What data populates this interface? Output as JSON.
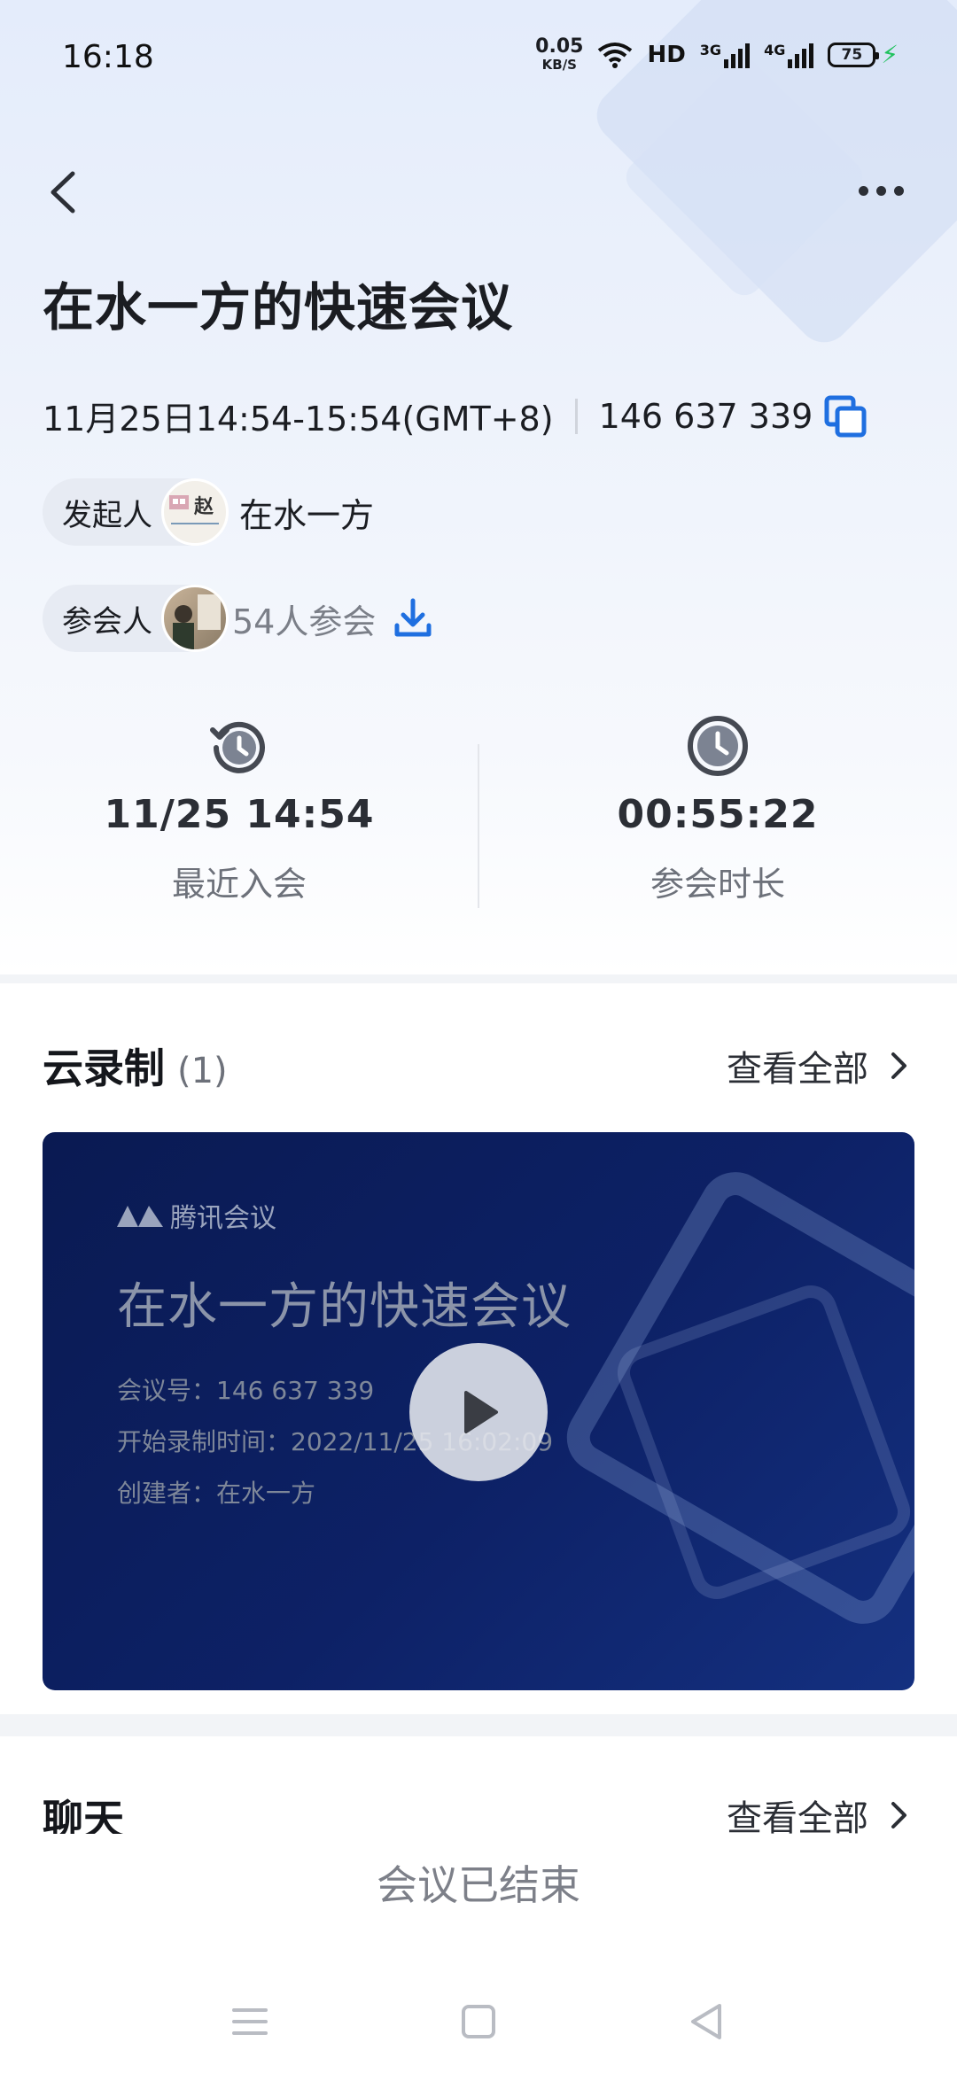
{
  "status_bar": {
    "time": "16:18",
    "speed_value": "0.05",
    "speed_unit": "KB/S",
    "hd_label": "HD",
    "net1": "3G",
    "net2": "4G",
    "battery": "75",
    "icons": [
      "wifi-icon",
      "signal-icon",
      "battery-icon",
      "charging-icon"
    ]
  },
  "nav": {
    "back_icon": "chevron-left-icon",
    "more_icon": "ellipsis-icon"
  },
  "meeting": {
    "title": "在水一方的快速会议",
    "time_range": "11月25日14:54-15:54(GMT+8)",
    "meeting_id": "146 637 339",
    "host_label": "发起人",
    "host_name": "在水一方",
    "host_avatar_text": "赵",
    "attendee_label": "参会人",
    "attendee_count": "54人参会"
  },
  "stats": {
    "last_join_value": "11/25 14:54",
    "last_join_label": "最近入会",
    "duration_value": "00:55:22",
    "duration_label": "参会时长"
  },
  "recording": {
    "section_title": "云录制",
    "count": "(1)",
    "view_all": "查看全部",
    "brand": "腾讯会议",
    "video_title": "在水一方的快速会议",
    "video_meeting_id": "会议号：146 637 339",
    "video_start_time": "开始录制时间：2022/11/25 16:02:09",
    "video_creator": "创建者：在水一方"
  },
  "chat": {
    "section_title": "聊天",
    "view_all": "查看全部"
  },
  "footer": {
    "ended_text": "会议已结束"
  },
  "colors": {
    "accent": "#1f6fe0",
    "header_bg": "#e6eefb",
    "video_bg": "#0d2166"
  }
}
